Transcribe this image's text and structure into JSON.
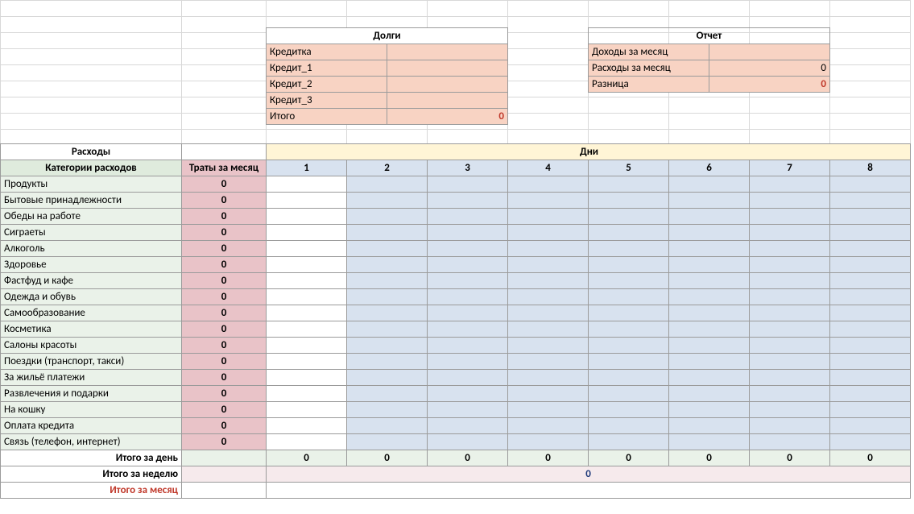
{
  "debts": {
    "title": "Долги",
    "rows": [
      {
        "label": "Кредитка",
        "value": ""
      },
      {
        "label": "Кредит_1",
        "value": ""
      },
      {
        "label": "Кредит_2",
        "value": ""
      },
      {
        "label": "Кредит_3",
        "value": ""
      }
    ],
    "total_label": "Итого",
    "total_value": "0"
  },
  "report": {
    "title": "Отчет",
    "rows": [
      {
        "label": "Доходы за месяц",
        "value": ""
      },
      {
        "label": "Расходы за месяц",
        "value": "0"
      },
      {
        "label": "Разница",
        "value": "0",
        "red": true
      }
    ]
  },
  "expenses": {
    "section_title": "Расходы",
    "cat_header": "Категории расходов",
    "month_header": "Траты за месяц",
    "days_title": "Дни",
    "days": [
      "1",
      "2",
      "3",
      "4",
      "5",
      "6",
      "7",
      "8"
    ],
    "categories": [
      "Продукты",
      "Бытовые принадлежности",
      "Обеды на работе",
      "Сиграеты",
      "Алкоголь",
      "Здоровье",
      "Фастфуд и кафе",
      "Одежда и обувь",
      "Самообразование",
      "Косметика",
      "Салоны красоты",
      "Поездки (транспорт, такси)",
      "За жильё платежи",
      "Развлечения и подарки",
      "На кошку",
      "Оплата кредита",
      "Связь (телефон, интернет)"
    ],
    "month_value": "0",
    "day_total_label": "Итого за день",
    "day_totals": [
      "0",
      "0",
      "0",
      "0",
      "0",
      "0",
      "0",
      "0"
    ],
    "week_total_label": "Итого за неделю",
    "week_total": "0",
    "month_total_label": "Итого за месяц"
  }
}
